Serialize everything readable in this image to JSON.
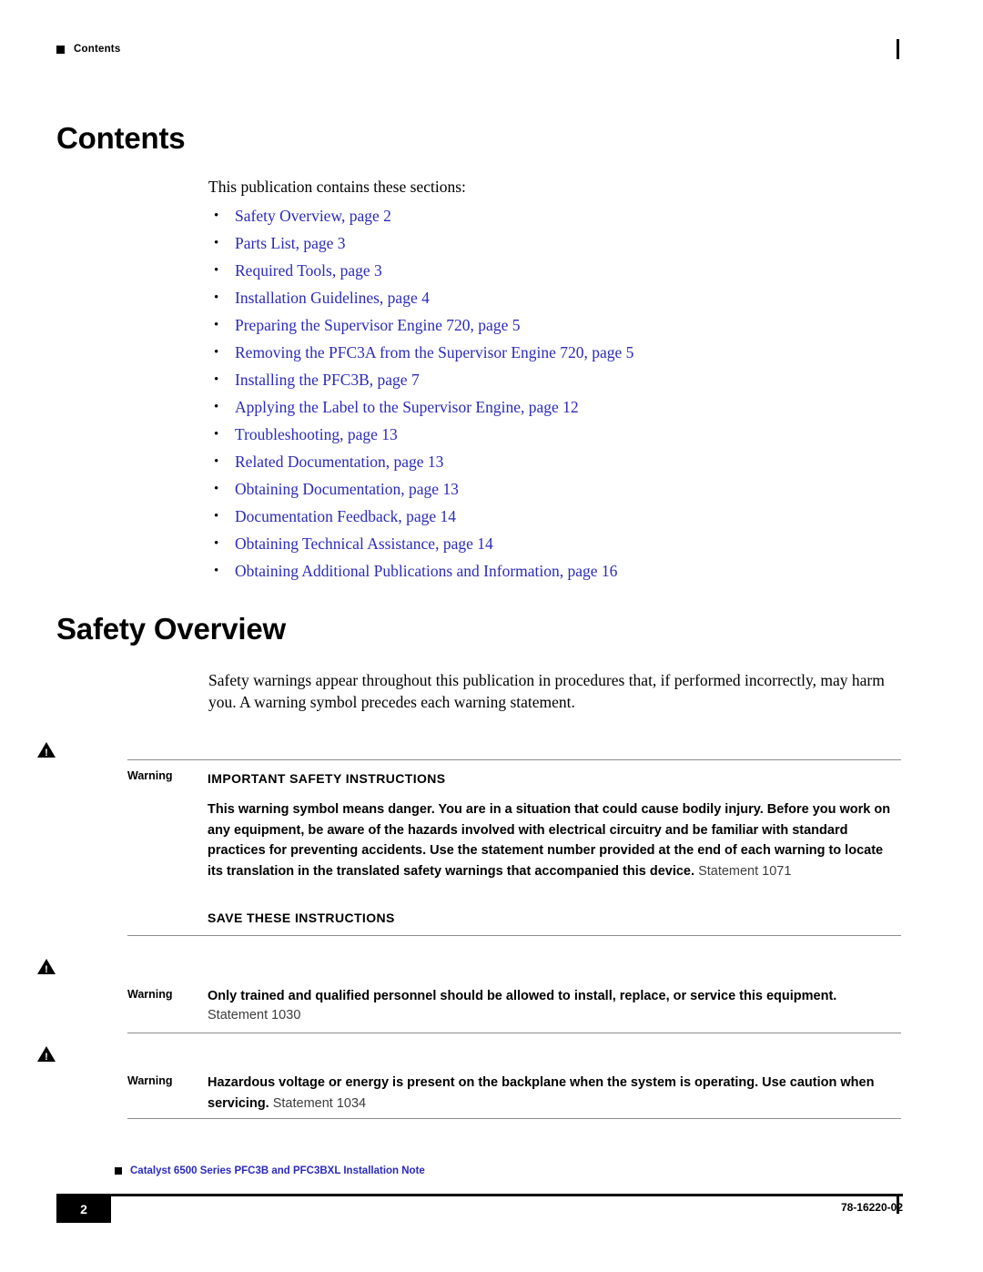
{
  "header": {
    "running_head": "Contents"
  },
  "contents": {
    "title": "Contents",
    "intro": "This publication contains these sections:",
    "items": [
      {
        "label": "Safety Overview, page 2"
      },
      {
        "label": "Parts List, page 3"
      },
      {
        "label": "Required Tools, page 3"
      },
      {
        "label": "Installation Guidelines, page 4"
      },
      {
        "label": "Preparing the Supervisor Engine 720, page 5"
      },
      {
        "label": "Removing the PFC3A from the Supervisor Engine 720, page 5"
      },
      {
        "label": "Installing the PFC3B, page 7"
      },
      {
        "label": "Applying the Label to the Supervisor Engine, page 12"
      },
      {
        "label": "Troubleshooting, page 13"
      },
      {
        "label": "Related Documentation, page 13"
      },
      {
        "label": "Obtaining Documentation, page 13"
      },
      {
        "label": "Documentation Feedback, page 14"
      },
      {
        "label": "Obtaining Technical Assistance, page 14"
      },
      {
        "label": "Obtaining Additional Publications and Information, page 16"
      }
    ]
  },
  "safety_overview": {
    "title": "Safety Overview",
    "intro": "Safety warnings appear throughout this publication in procedures that, if performed incorrectly, may harm you. A warning symbol precedes each warning statement.",
    "warnings": [
      {
        "label": "Warning",
        "heading": "IMPORTANT SAFETY INSTRUCTIONS",
        "body_bold": "This warning symbol means danger. You are in a situation that could cause bodily injury. Before you work on any equipment, be aware of the hazards involved with electrical circuitry and be familiar with standard practices for preventing accidents. Use the statement number provided at the end of each warning to locate its translation in the translated safety warnings that accompanied this device.",
        "statement": "Statement 1071",
        "footer_heading": "SAVE THESE INSTRUCTIONS"
      },
      {
        "label": "Warning",
        "body_bold": "Only trained and qualified personnel should be allowed to install, replace, or service this equipment.",
        "statement": "Statement 1030"
      },
      {
        "label": "Warning",
        "body_bold": "Hazardous voltage or energy is present on the backplane when the system is operating. Use caution when servicing.",
        "statement": "Statement 1034"
      }
    ]
  },
  "footer": {
    "doc_title": "Catalyst 6500 Series PFC3B and PFC3BXL Installation Note",
    "page_number": "2",
    "part_number": "78-16220-02"
  }
}
